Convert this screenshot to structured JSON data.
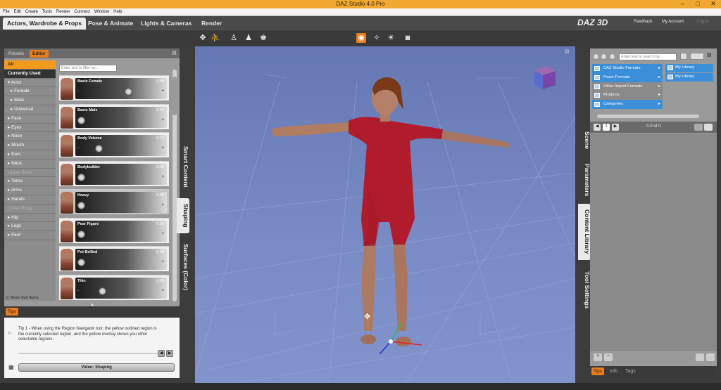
{
  "window": {
    "title": "DAZ Studio 4.0 Pro",
    "min": "–",
    "max": "□",
    "close": "✕"
  },
  "menu": [
    "File",
    "Edit",
    "Create",
    "Tools",
    "Render",
    "Connect",
    "Window",
    "Help"
  ],
  "main_tabs": [
    "Actors, Wardrobe & Props",
    "Pose & Animate",
    "Lights & Cameras",
    "Render"
  ],
  "logo": "DAZ 3D",
  "links": {
    "feedback": "Feedback",
    "account": "My Account",
    "login": "Log In"
  },
  "left_panel": {
    "tabs": [
      "Presets",
      "Editor"
    ],
    "categories": [
      {
        "label": "All",
        "style": "all"
      },
      {
        "label": "Currently Used",
        "style": "cu"
      },
      {
        "label": "▾ Actor",
        "style": ""
      },
      {
        "label": "▸ Female",
        "style": "sub"
      },
      {
        "label": "▸ Male",
        "style": "sub"
      },
      {
        "label": "▸ Universal",
        "style": "sub"
      },
      {
        "label": "▸ Face",
        "style": ""
      },
      {
        "label": "▸ Eyes",
        "style": ""
      },
      {
        "label": "▸ Nose",
        "style": ""
      },
      {
        "label": "▸ Mouth",
        "style": ""
      },
      {
        "label": "▸ Ears",
        "style": ""
      },
      {
        "label": "▸ Neck",
        "style": ""
      },
      {
        "label": "Upper Body",
        "style": "dim"
      },
      {
        "label": "▸ Torso",
        "style": ""
      },
      {
        "label": "▸ Arms",
        "style": ""
      },
      {
        "label": "▸ Hands",
        "style": ""
      },
      {
        "label": "Lower Body",
        "style": "dim"
      },
      {
        "label": "▸ Hip",
        "style": ""
      },
      {
        "label": "▸ Legs",
        "style": ""
      },
      {
        "label": "▸ Feet",
        "style": ""
      }
    ],
    "show_sub_items": "Show Sub Items",
    "filter_placeholder": "Enter text to filter by...",
    "morphs": [
      {
        "name": "Basic Female",
        "value": "0.58",
        "level": 0.58
      },
      {
        "name": "Basic Male",
        "value": "0.00",
        "level": 0
      },
      {
        "name": "Body Volume",
        "value": "0.22",
        "level": 0.22
      },
      {
        "name": "Bodybuilder",
        "value": "0.00",
        "level": 0
      },
      {
        "name": "Heavy",
        "value": "0.00",
        "level": 0
      },
      {
        "name": "Pear Figure",
        "value": "0.00",
        "level": 0
      },
      {
        "name": "Pot Bellied",
        "value": "0.00",
        "level": 0
      },
      {
        "name": "Thin",
        "value": "0.26",
        "level": 0.26
      }
    ],
    "side_tabs": [
      "Smart Content",
      "Shaping",
      "Surfaces (Color)"
    ]
  },
  "tips": {
    "label": "Tips",
    "text": "Tip 1 - When using the Region Navigator tool; the yellow outlined region is the currently selected region, and the yellow overlay shows you other selectable regions.",
    "video_button": "Video: Shaping"
  },
  "right_panel": {
    "search_placeholder": "Enter text to search by...",
    "tree": [
      {
        "label": "DAZ Studio Formats",
        "sel": true
      },
      {
        "label": "Poser Formats",
        "sel": true
      },
      {
        "label": "Other Import Formats",
        "sel": false
      },
      {
        "label": "Products",
        "sel": false
      },
      {
        "label": "Categories",
        "sel": true
      }
    ],
    "libraries": [
      "My Library",
      "My Library"
    ],
    "page": "1",
    "count": "0-0 of 0",
    "side_tabs": [
      "Scene",
      "Parameters",
      "Content Library",
      "Tool Settings"
    ],
    "bottom_tabs": [
      "Tips",
      "Info",
      "Tags"
    ]
  }
}
